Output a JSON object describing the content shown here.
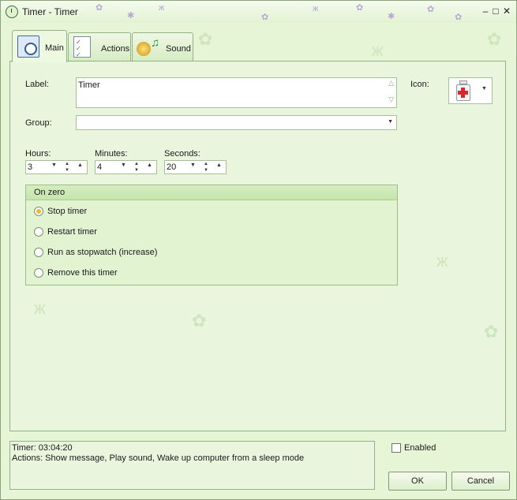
{
  "window": {
    "title": "Timer - Timer",
    "minimize_glyph": "–",
    "maximize_glyph": "□",
    "close_glyph": "✕"
  },
  "tabs": [
    {
      "label": "Main",
      "icon": "clock-calendar-icon",
      "active": true
    },
    {
      "label": "Actions",
      "icon": "checklist-icon",
      "active": false
    },
    {
      "label": "Sound",
      "icon": "speaker-icon",
      "active": false
    }
  ],
  "main": {
    "label_caption": "Label:",
    "label_value": "Timer",
    "icon_caption": "Icon:",
    "icon_name": "medicine-bottle-icon",
    "group_caption": "Group:",
    "group_value": "",
    "hours_caption": "Hours:",
    "hours_value": "3",
    "minutes_caption": "Minutes:",
    "minutes_value": "4",
    "seconds_caption": "Seconds:",
    "seconds_value": "20",
    "on_zero": {
      "title": "On zero",
      "options": [
        {
          "label": "Stop timer",
          "selected": true
        },
        {
          "label": "Restart timer",
          "selected": false
        },
        {
          "label": "Run as stopwatch (increase)",
          "selected": false
        },
        {
          "label": "Remove this timer",
          "selected": false
        }
      ]
    }
  },
  "status": {
    "line1": "Timer: 03:04:20",
    "line2": "Actions: Show message, Play sound, Wake up computer from a sleep mode"
  },
  "enabled": {
    "label": "Enabled",
    "checked": false
  },
  "buttons": {
    "ok": "OK",
    "cancel": "Cancel"
  },
  "colors": {
    "window_bg": "#e6f5d6",
    "border": "#93b382",
    "radio_selected": "#f0b53a"
  }
}
